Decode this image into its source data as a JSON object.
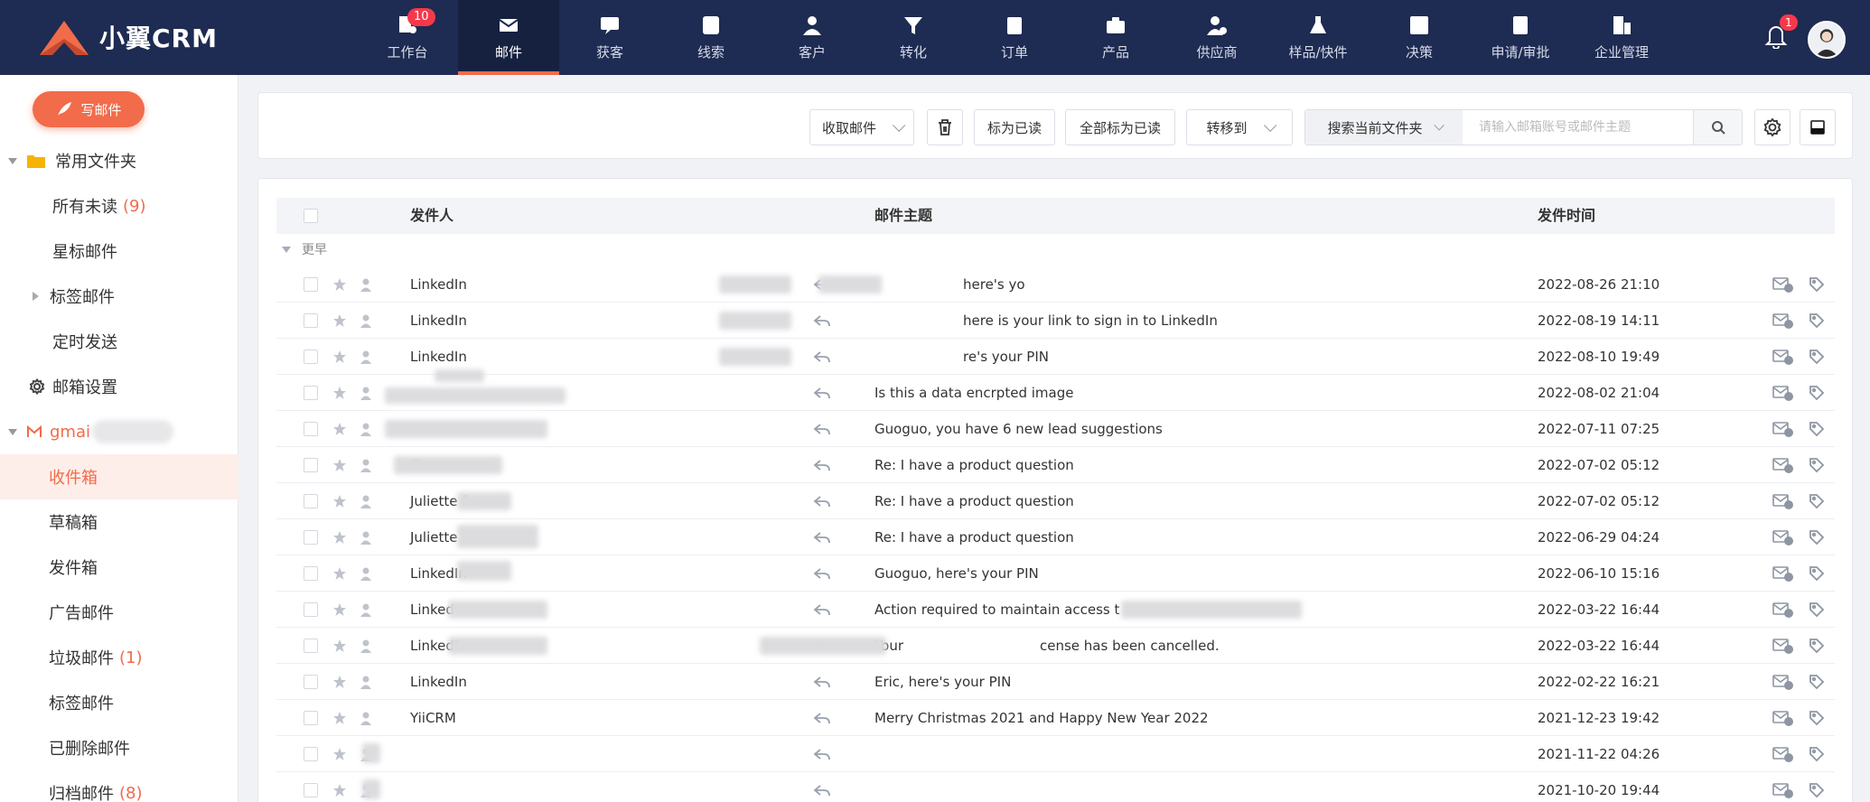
{
  "app": {
    "logo_text": "小翼CRM"
  },
  "nav": {
    "items": [
      {
        "label": "工作台",
        "icon": "workbench-icon",
        "badge": "10"
      },
      {
        "label": "邮件",
        "icon": "mail-icon",
        "active": true
      },
      {
        "label": "获客",
        "icon": "acquire-icon"
      },
      {
        "label": "线索",
        "icon": "leads-icon"
      },
      {
        "label": "客户",
        "icon": "customer-icon"
      },
      {
        "label": "转化",
        "icon": "funnel-icon"
      },
      {
        "label": "订单",
        "icon": "order-icon"
      },
      {
        "label": "产品",
        "icon": "product-icon"
      },
      {
        "label": "供应商",
        "icon": "supplier-icon"
      },
      {
        "label": "样品/快件",
        "icon": "sample-icon"
      },
      {
        "label": "决策",
        "icon": "decision-icon"
      },
      {
        "label": "申请/审批",
        "icon": "approval-icon"
      },
      {
        "label": "企业管理",
        "icon": "enterprise-icon"
      }
    ],
    "bell_badge": "1"
  },
  "sidebar": {
    "compose_label": "写邮件",
    "common_folder": "常用文件夹",
    "all_unread": "所有未读",
    "all_unread_count": "(9)",
    "starred": "星标邮件",
    "tagged": "标签邮件",
    "scheduled": "定时发送",
    "settings": "邮箱设置",
    "account_prefix": "gmai",
    "inbox": "收件箱",
    "drafts": "草稿箱",
    "sent": "发件箱",
    "ads": "广告邮件",
    "spam": "垃圾邮件",
    "spam_count": "(1)",
    "tag_mail": "标签邮件",
    "deleted": "已删除邮件",
    "archived": "归档邮件",
    "archived_count": "(8)"
  },
  "toolbar": {
    "receive": "收取邮件",
    "mark_read": "标为已读",
    "mark_all_read": "全部标为已读",
    "move_to": "转移到",
    "search_scope": "搜索当前文件夹",
    "search_placeholder": "请输入邮箱账号或邮件主题"
  },
  "table": {
    "columns": {
      "sender": "发件人",
      "subject": "邮件主题",
      "time": "发件时间"
    },
    "group_label": "更早",
    "rows": [
      {
        "sender": "LinkedIn",
        "subject": "here's yo",
        "time": "2022-08-26 21:10"
      },
      {
        "sender": "LinkedIn",
        "subject": "here is your link to sign in to LinkedIn",
        "time": "2022-08-19 14:11"
      },
      {
        "sender": "LinkedIn",
        "subject": "re's your PIN",
        "time": "2022-08-10 19:49"
      },
      {
        "sender": "",
        "subject": "Is this a data encrpted image",
        "time": "2022-08-02 21:04"
      },
      {
        "sender": "",
        "subject": "Guoguo, you have 6 new lead suggestions",
        "time": "2022-07-11 07:25"
      },
      {
        "sender": "C",
        "subject": "Re: I have a product question",
        "time": "2022-07-02 05:12"
      },
      {
        "sender": "Juliette fro",
        "subject": "Re: I have a product question",
        "time": "2022-07-02 05:12"
      },
      {
        "sender": "Juliette",
        "subject": "Re: I have a product question",
        "time": "2022-06-29 04:24"
      },
      {
        "sender": "LinkedIn",
        "subject": "Guoguo, here's your PIN",
        "time": "2022-06-10 15:16"
      },
      {
        "sender": "Linked",
        "subject": "Action required to maintain access t",
        "time": "2022-03-22 16:44"
      },
      {
        "sender": "LinkedIn",
        "subject": "Your",
        "subject_tail": "cense has been cancelled.",
        "time": "2022-03-22 16:44"
      },
      {
        "sender": "LinkedIn",
        "subject": "Eric, here's your PIN",
        "time": "2022-02-22 16:21"
      },
      {
        "sender": "YiiCRM",
        "subject": "Merry Christmas 2021 and Happy New Year 2022",
        "time": "2021-12-23 19:42"
      },
      {
        "sender": "",
        "subject": "",
        "time": "2021-11-22 04:26"
      },
      {
        "sender": "",
        "subject": "",
        "time": "2021-10-20 19:44"
      }
    ]
  },
  "colors": {
    "nav_bg": "#1e2b52",
    "accent": "#f26b4a",
    "badge": "#f5394b"
  }
}
